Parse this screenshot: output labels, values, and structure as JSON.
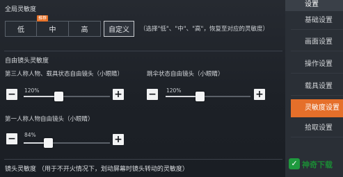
{
  "global": {
    "title": "全局灵敏度",
    "badge": "推荐",
    "buttons": [
      {
        "label": "低"
      },
      {
        "label": "中"
      },
      {
        "label": "高"
      },
      {
        "label": "自定义"
      }
    ],
    "hint": "（选择\"低\"、\"中\"、\"高\"，恢复至对应的灵敏度）"
  },
  "free_look": {
    "title": "自由镜头灵敏度",
    "rows": [
      {
        "label": "第三人称人物、载具状态自由镜头（小眼睛）",
        "value_text": "120%",
        "value": 120,
        "max": 300
      },
      {
        "label": "跳伞状态自由镜头（小眼睛）",
        "value_text": "120%",
        "value": 120,
        "max": 300
      },
      {
        "label": "第一人称人物自由镜头（小眼睛）",
        "value_text": "84%",
        "value": 84,
        "max": 300
      }
    ]
  },
  "camera": {
    "title": "镜头灵敏度 （用于不开火情况下，划动屏幕时镜头转动的灵敏度）"
  },
  "sidebar": {
    "header": "设置",
    "items": [
      {
        "label": "基础设置",
        "active": false
      },
      {
        "label": "画面设置",
        "active": false
      },
      {
        "label": "操作设置",
        "active": false
      },
      {
        "label": "载具设置",
        "active": false
      },
      {
        "label": "灵敏度设置",
        "active": true
      },
      {
        "label": "拾取设置",
        "active": false
      }
    ]
  },
  "watermark": {
    "text": "神奇下载",
    "icon": "check-icon"
  },
  "colors": {
    "accent": "#e56f2a",
    "watermark": "#1f9a3e"
  }
}
